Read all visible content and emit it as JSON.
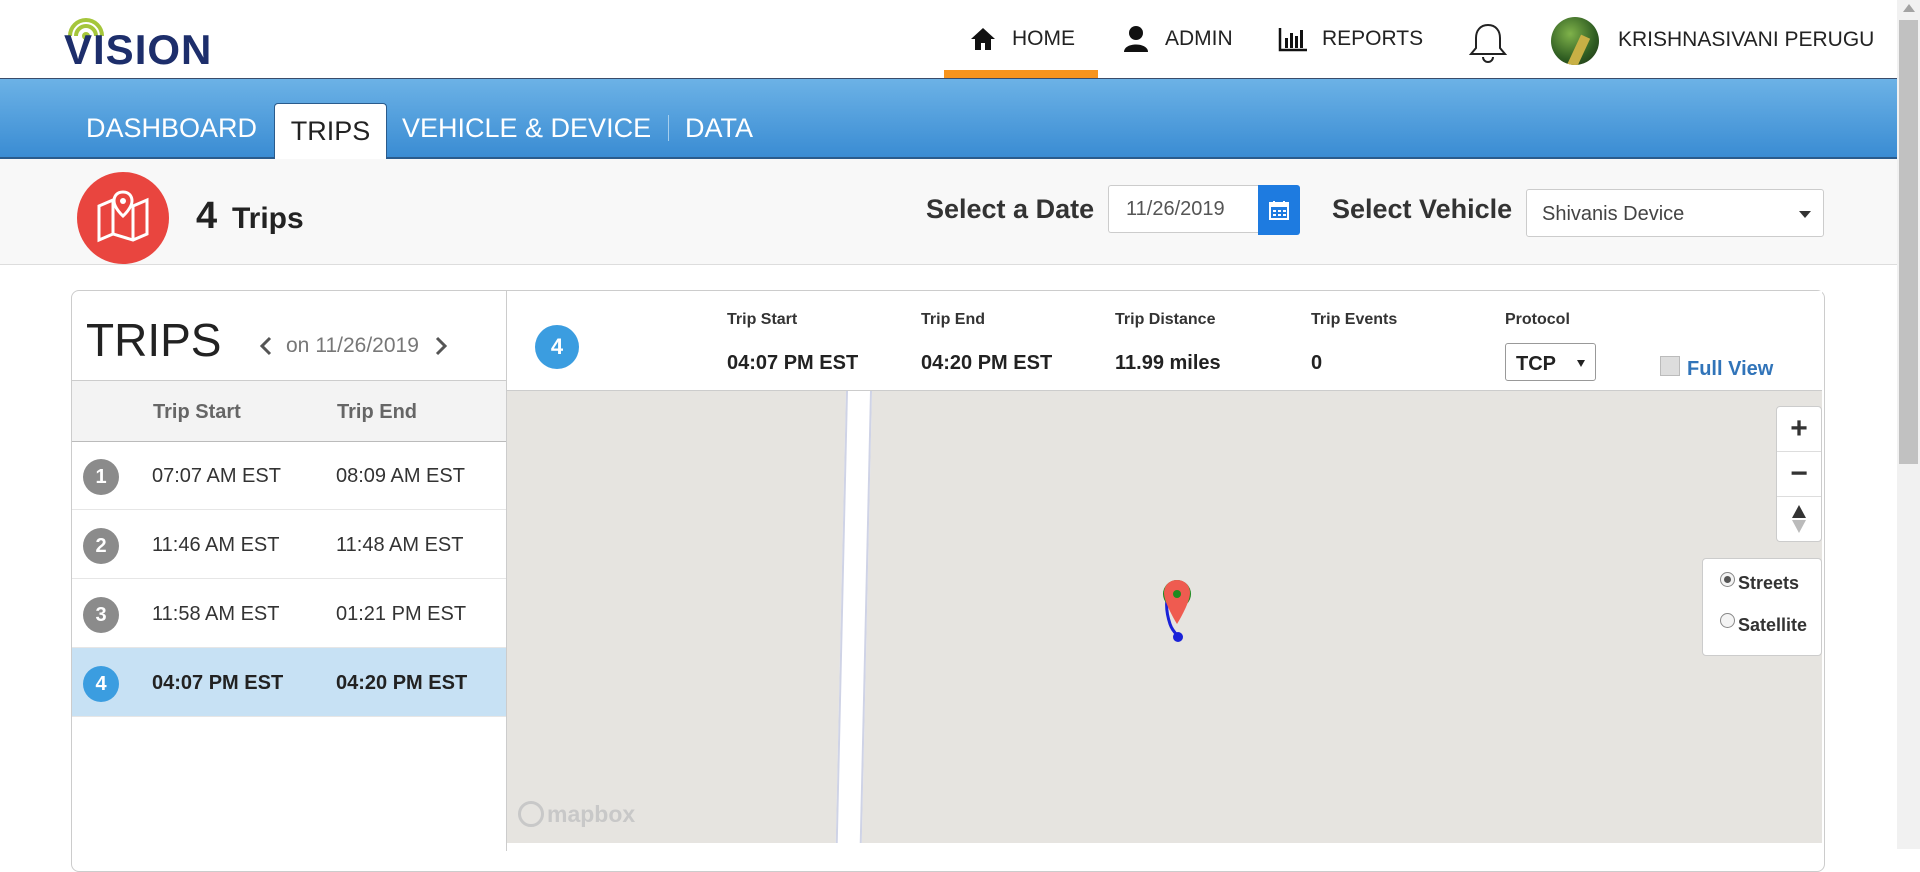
{
  "header": {
    "logo": "VISION",
    "nav": [
      {
        "label": "HOME",
        "icon": "home-icon"
      },
      {
        "label": "ADMIN",
        "icon": "user-icon"
      },
      {
        "label": "REPORTS",
        "icon": "bar-chart-icon"
      }
    ],
    "notification_icon": "bell-icon",
    "username": "KRISHNASIVANI PERUGU",
    "active_nav_color": "#f7941d"
  },
  "tabs": [
    {
      "label": "DASHBOARD"
    },
    {
      "label": "TRIPS",
      "active": true
    },
    {
      "label": "VEHICLE & DEVICE"
    },
    {
      "label": "DATA"
    }
  ],
  "summary": {
    "count": "4",
    "count_label": "Trips",
    "select_date_label": "Select a Date",
    "date_value": "11/26/2019",
    "select_vehicle_label": "Select Vehicle",
    "vehicle_value": "Shivanis Device"
  },
  "trips_list": {
    "title": "TRIPS",
    "date_prefix": "on",
    "date": "11/26/2019",
    "columns": [
      "Trip Start",
      "Trip End"
    ],
    "rows": [
      {
        "num": "1",
        "start": "07:07 AM EST",
        "end": "08:09 AM EST"
      },
      {
        "num": "2",
        "start": "11:46 AM EST",
        "end": "11:48 AM EST"
      },
      {
        "num": "3",
        "start": "11:58 AM EST",
        "end": "01:21 PM EST"
      },
      {
        "num": "4",
        "start": "04:07 PM EST",
        "end": "04:20 PM EST",
        "selected": true
      }
    ]
  },
  "trip_detail": {
    "num": "4",
    "start_label": "Trip Start",
    "start_value": "04:07 PM EST",
    "end_label": "Trip End",
    "end_value": "04:20 PM EST",
    "distance_label": "Trip Distance",
    "distance_value": "11.99 miles",
    "events_label": "Trip Events",
    "events_value": "0",
    "protocol_label": "Protocol",
    "protocol_value": "TCP",
    "full_view_label": "Full View"
  },
  "map": {
    "zoom_in": "+",
    "zoom_out": "−",
    "layers": [
      {
        "label": "Streets",
        "selected": true
      },
      {
        "label": "Satellite",
        "selected": false
      }
    ],
    "attribution": "mapbox"
  }
}
